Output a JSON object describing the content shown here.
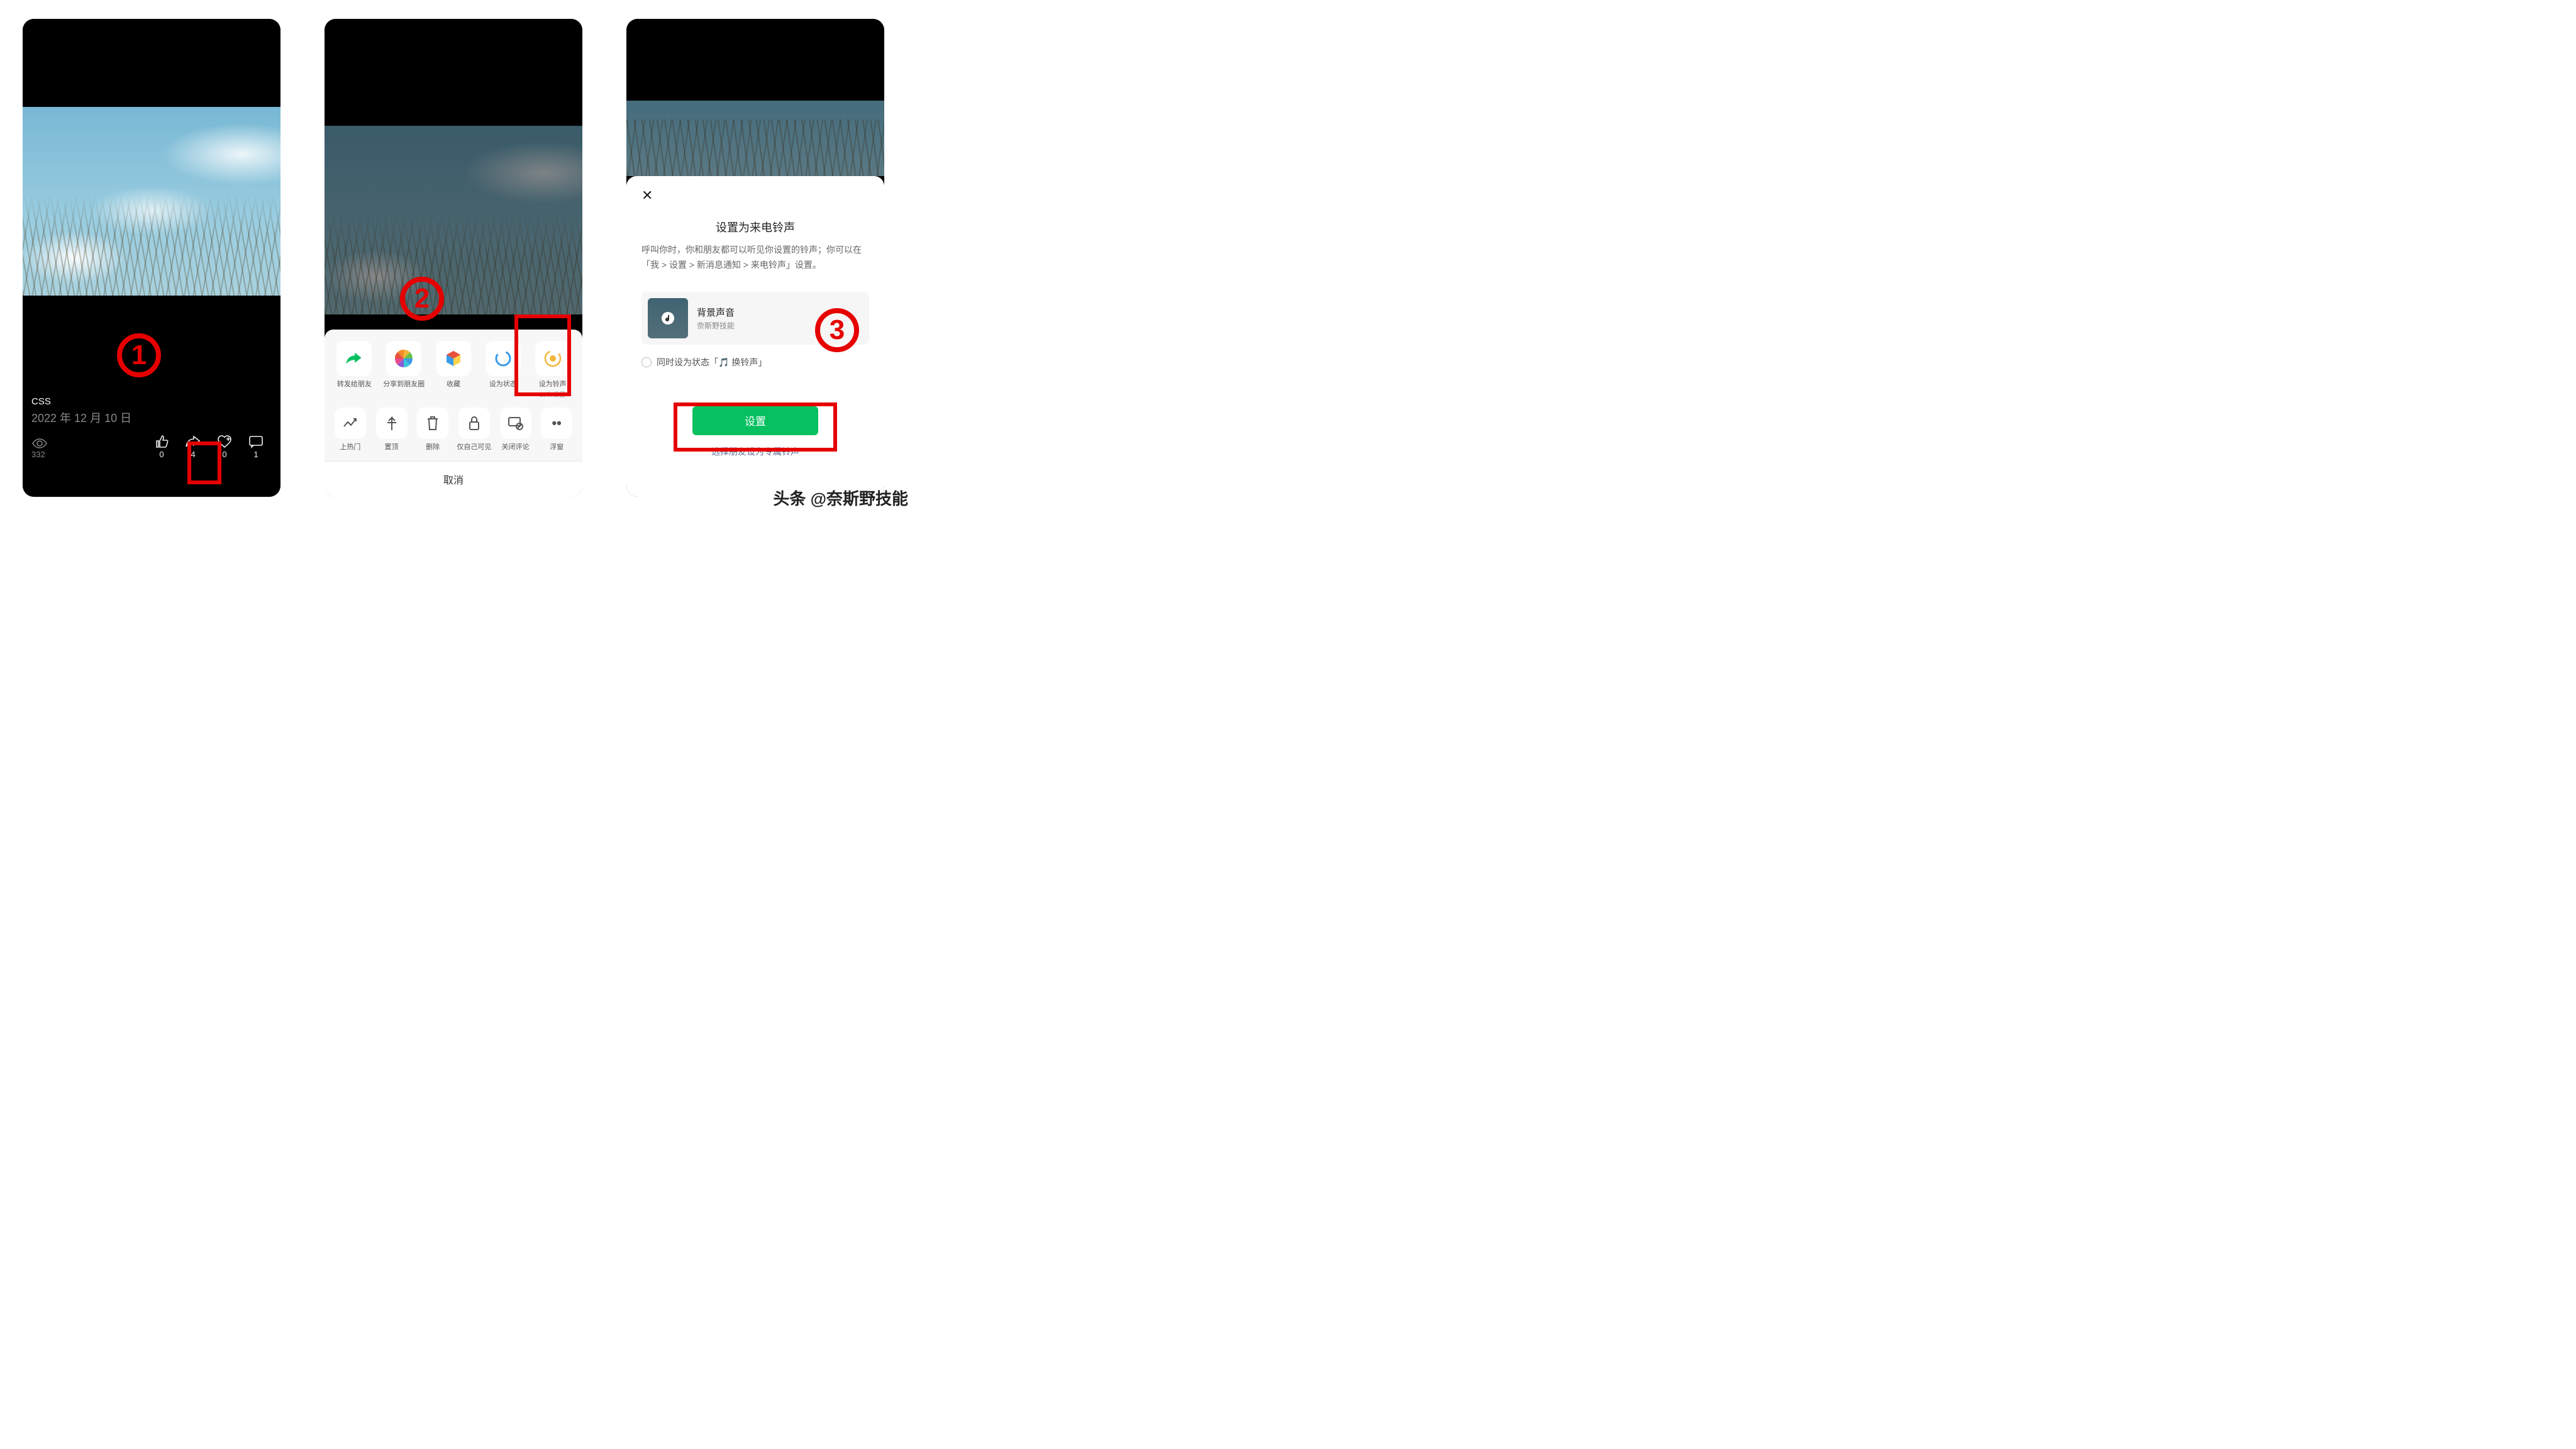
{
  "screen1": {
    "marker": "1",
    "title": "CSS",
    "date": "2022 年 12 月 10 日",
    "views": "332",
    "actions": {
      "like": "0",
      "share": "4",
      "fav": "0",
      "comment": "1"
    }
  },
  "screen2": {
    "marker": "2",
    "row1": [
      {
        "label": "转发给朋友",
        "sub": ""
      },
      {
        "label": "分享到朋友圈",
        "sub": ""
      },
      {
        "label": "收藏",
        "sub": ""
      },
      {
        "label": "设为状态",
        "sub": ""
      },
      {
        "label": "设为铃声",
        "sub": "19次设置"
      }
    ],
    "row2": [
      {
        "label": "上热门"
      },
      {
        "label": "置顶"
      },
      {
        "label": "删除"
      },
      {
        "label": "仅自己可见"
      },
      {
        "label": "关闭评论"
      },
      {
        "label": "浮窗"
      }
    ],
    "cancel": "取消"
  },
  "screen3": {
    "marker": "3",
    "heading": "设置为来电铃声",
    "desc": "呼叫你时，你和朋友都可以听见你设置的铃声；你可以在「我 > 设置 > 新消息通知 > 来电铃声」设置。",
    "card": {
      "title": "背景声音",
      "sub": "奈斯野技能"
    },
    "checkbox": "同时设为状态「🎵 换铃声」",
    "button": "设置",
    "link": "选择朋友设为专属铃声"
  },
  "watermark": "头条 @奈斯野技能"
}
